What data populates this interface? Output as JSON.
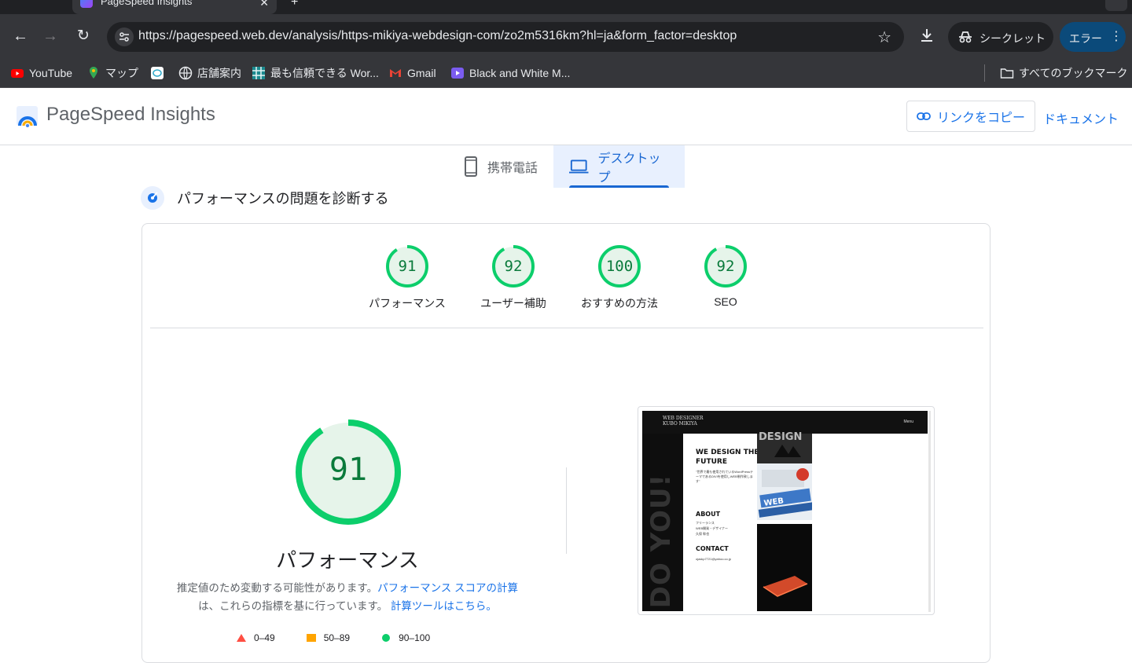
{
  "browser": {
    "tab_title": "PageSpeed Insights",
    "url": "https://pagespeed.web.dev/analysis/https-mikiya-webdesign-com/zo2m5316km?hl=ja&form_factor=desktop",
    "incognito_label": "シークレット",
    "error_label": "エラー",
    "bookmarks": [
      {
        "label": "YouTube",
        "icon": "youtube-icon"
      },
      {
        "label": "マップ",
        "icon": "maps-icon"
      },
      {
        "label": "",
        "icon": "site-icon"
      },
      {
        "label": "店舗案内",
        "icon": "globe-icon"
      },
      {
        "label": "最も信頼できる Wor...",
        "icon": "grid-icon"
      },
      {
        "label": "Gmail",
        "icon": "gmail-icon"
      },
      {
        "label": "Black and White M...",
        "icon": "video-icon"
      }
    ],
    "all_bookmarks_label": "すべてのブックマーク"
  },
  "header": {
    "brand": "PageSpeed Insights",
    "copy_link_label": "リンクをコピー",
    "docs_label": "ドキュメント"
  },
  "device_tabs": [
    {
      "label": "携帯電話",
      "active": false
    },
    {
      "label": "デスクトップ",
      "active": true
    }
  ],
  "diagnose_title": "パフォーマンスの問題を診断する",
  "scores": [
    {
      "value": 91,
      "label": "パフォーマンス"
    },
    {
      "value": 92,
      "label": "ユーザー補助"
    },
    {
      "value": 100,
      "label": "おすすめの方法"
    },
    {
      "value": 92,
      "label": "SEO"
    }
  ],
  "performance": {
    "score": 91,
    "title": "パフォーマンス",
    "note_prefix": "推定値のため変動する可能性があります。",
    "note_link1": "パフォーマンス スコアの計算",
    "note_middle": "は、これらの指標を基に行っています。",
    "note_link2": "計算ツールはこちら。",
    "legend": [
      {
        "range": "0–49",
        "color": "#ff4e42"
      },
      {
        "range": "50–89",
        "color": "#ffa400"
      },
      {
        "range": "90–100",
        "color": "#0cce6b"
      }
    ]
  },
  "preview": {
    "brand_line1": "WEB DESIGNER",
    "brand_line2": "KUBO MIKIYA",
    "menu": "Menu",
    "heading_line1": "WE DESIGN THE",
    "heading_line2": "FUTURE",
    "tagline": "\"世界で最も使用されているWordPressテーマであるDIVIを使用しWEB制作致します\"",
    "about": "ABOUT",
    "about_lines": [
      "フリーランス",
      "WEB開発・デザイナー",
      "久保 幹也"
    ],
    "contact": "CONTACT",
    "email": "ojaskp7721@yahoo.co.jp",
    "side_text": "DO YOU!",
    "img_text": "DESIGN"
  },
  "colors": {
    "pass": "#0cce6b",
    "pass_text": "#0a7a3b",
    "link": "#1a73e8"
  }
}
